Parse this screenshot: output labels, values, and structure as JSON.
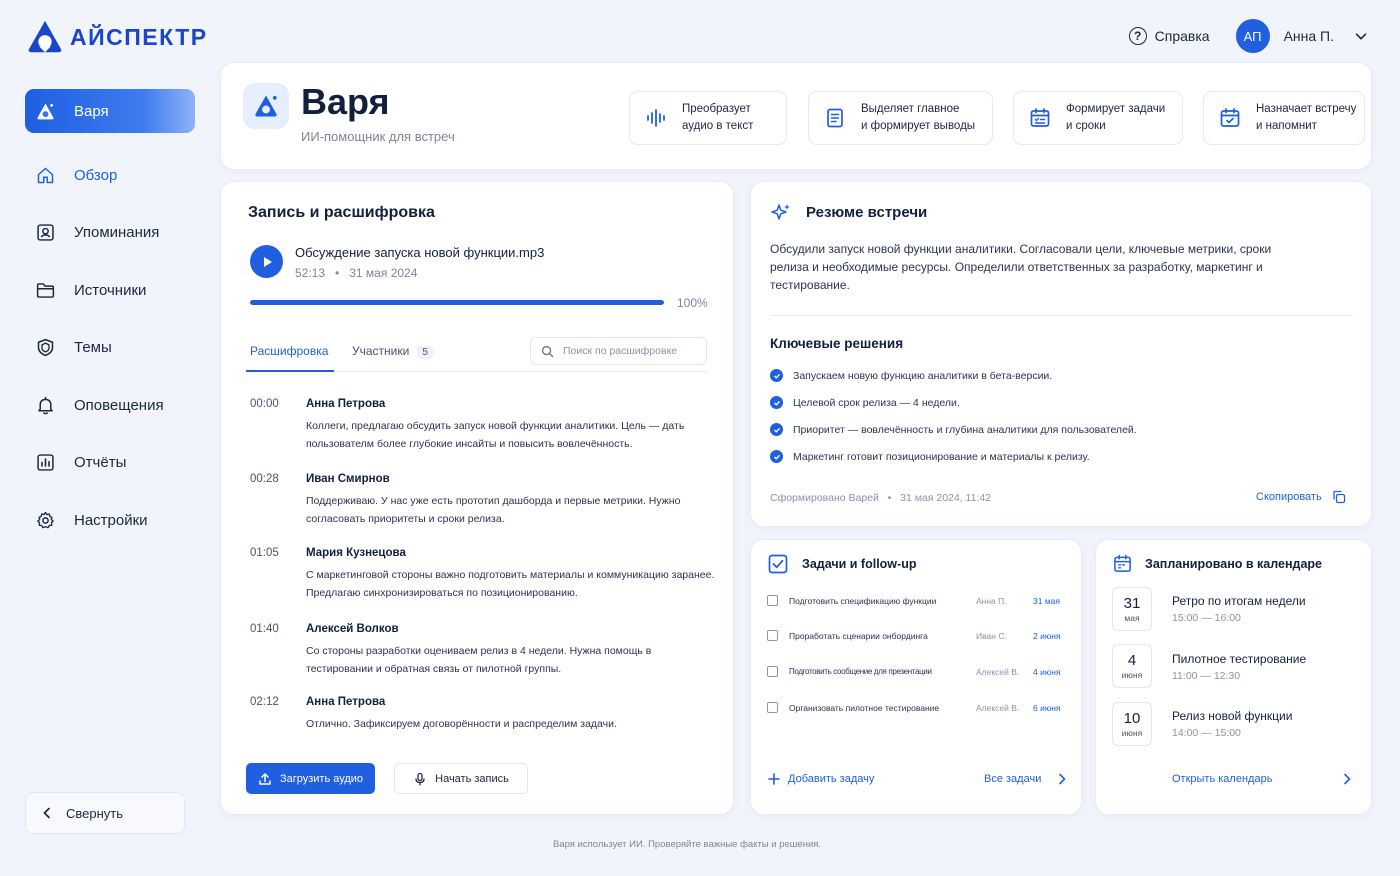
{
  "brand": {
    "name": "АЙСПЕКТР"
  },
  "topbar": {
    "help_label": "Справка",
    "user_initials": "АП",
    "user_name": "Анна П."
  },
  "sidebar": {
    "active_label": "Варя",
    "items": [
      {
        "label": "Обзор",
        "icon": "home-icon"
      },
      {
        "label": "Упоминания",
        "icon": "mention-icon"
      },
      {
        "label": "Источники",
        "icon": "folder-icon"
      },
      {
        "label": "Темы",
        "icon": "shield-icon"
      },
      {
        "label": "Оповещения",
        "icon": "bell-icon"
      },
      {
        "label": "Отчёты",
        "icon": "chart-icon"
      },
      {
        "label": "Настройки",
        "icon": "gear-icon"
      }
    ],
    "collapse_label": "Свернуть"
  },
  "assistant": {
    "title": "Варя",
    "subtitle": "ИИ-помощник для встреч",
    "features": [
      {
        "line1": "Преобразует",
        "line2": "аудио в текст",
        "icon": "audio-wave-icon"
      },
      {
        "line1": "Выделяет главное",
        "line2": "и формирует выводы",
        "icon": "document-icon"
      },
      {
        "line1": "Формирует задачи",
        "line2": "и сроки",
        "icon": "calendar-tasks-icon"
      },
      {
        "line1": "Назначает встречу",
        "line2": "и напомнит",
        "icon": "calendar-check-icon"
      }
    ]
  },
  "transcript": {
    "title": "Запись и расшифровка",
    "file_name": "Обсуждение запуска новой функции.mp3",
    "duration": "52:13",
    "date": "31 мая 2024",
    "progress_percent": 100,
    "progress_label": "100%",
    "tab_transcript": "Расшифровка",
    "tab_participants": "Участники",
    "participants_count": "5",
    "search_placeholder": "Поиск по расшифровке",
    "entries": [
      {
        "time": "00:00",
        "speaker": "Анна Петрова",
        "text": "Коллеги, предлагаю обсудить запуск новой функции аналитики. Цель — дать пользователм более глубокие инсайты и повысить вовлечённость."
      },
      {
        "time": "00:28",
        "speaker": "Иван Смирнов",
        "text": "Поддерживаю. У нас уже есть прототип дашборда и первые метрики. Нужно согласовать приоритеты и сроки релиза."
      },
      {
        "time": "01:05",
        "speaker": "Мария Кузнецова",
        "text": "С маркетинговой стороны важно подготовить материалы и коммуникацию заранее. Предлагаю синхронизироваться по позиционированию."
      },
      {
        "time": "01:40",
        "speaker": "Алексей Волков",
        "text": "Со стороны разработки оцениваем релиз в 4 недели. Нужна помощь в тестировании и обратная связь от пилотной группы."
      },
      {
        "time": "02:12",
        "speaker": "Анна Петрова",
        "text": "Отлично. Зафиксируем договорённости и распределим задачи."
      }
    ],
    "upload_label": "Загрузить аудио",
    "record_label": "Начать запись"
  },
  "summary": {
    "title": "Резюме встречи",
    "text": "Обсудили запуск новой функции аналитики. Согласовали цели, ключевые метрики, сроки релиза и необходимые ресурсы. Определили ответственных за разработку, маркетинг и тестирование.",
    "decisions_title": "Ключевые решения",
    "decisions": [
      "Запускаем новую функцию аналитики в бета-версии.",
      "Целевой срок релиза — 4 недели.",
      "Приоритет — вовлечённость и глубина аналитики для пользователей.",
      "Маркетинг готовит позиционирование и материалы к релизу."
    ],
    "generated_by": "Сформировано Варей",
    "generated_at": "31 мая 2024, 11:42",
    "copy_label": "Скопировать"
  },
  "tasks": {
    "title": "Задачи и follow-up",
    "items": [
      {
        "label": "Подготовить спецификацию функции",
        "owner": "Анна П.",
        "due": "31 мая"
      },
      {
        "label": "Проработать сценарии онбординга",
        "owner": "Иван С.",
        "due": "2 июня"
      },
      {
        "label": "Подготовить сообщение для презентации",
        "owner": "Алексей В.",
        "due": "4 июня"
      },
      {
        "label": "Организовать пилотное тестирование",
        "owner": "Алексей В.",
        "due": "6 июня"
      }
    ],
    "add_label": "Добавить задачу",
    "all_label": "Все задачи"
  },
  "calendar": {
    "title": "Запланировано в календаре",
    "events": [
      {
        "day": "31",
        "month": "мая",
        "title": "Ретро по итогам недели",
        "time": "15:00 — 16:00"
      },
      {
        "day": "4",
        "month": "июня",
        "title": "Пилотное тестирование",
        "time": "11:00 — 12:30"
      },
      {
        "day": "10",
        "month": "июня",
        "title": "Релиз новой функции",
        "time": "14:00 — 15:00"
      }
    ],
    "open_label": "Открыть календарь"
  },
  "footer": {
    "note": "Варя использует ИИ. Проверяйте важные факты и решения."
  },
  "colors": {
    "accent": "#1f5fe0",
    "background": "#f1f4fa",
    "text": "#13203d"
  }
}
